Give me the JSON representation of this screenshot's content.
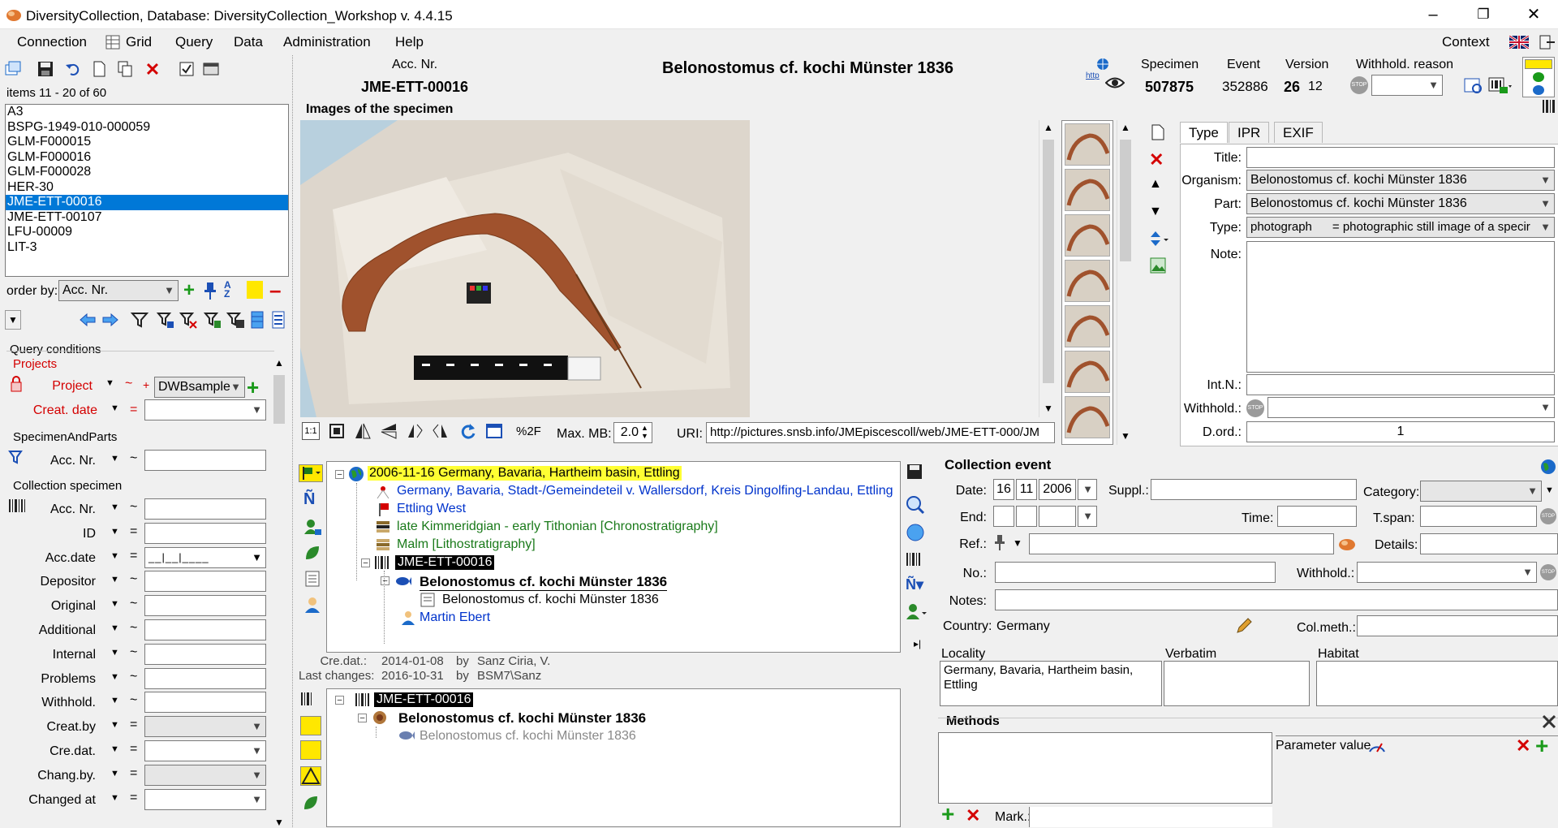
{
  "app": {
    "title": "DiversityCollection,  Database: DiversityCollection_Workshop    v. 4.4.15"
  },
  "menu": [
    "Connection",
    "Grid",
    "Query",
    "Data",
    "Administration",
    "Help"
  ],
  "context_label": "Context",
  "list": {
    "count_label": "items 11 - 20 of 60",
    "items": [
      "A3",
      "BSPG-1949-010-000059",
      "GLM-F000015",
      "GLM-F000016",
      "GLM-F000028",
      "HER-30",
      "JME-ETT-00016",
      "JME-ETT-00107",
      "LFU-00009",
      "LIT-3"
    ],
    "selected_index": 6
  },
  "orderby": {
    "label": "order by:",
    "value": "Acc. Nr."
  },
  "query": {
    "header": "Query conditions",
    "projects_group": "Projects",
    "project_label": "Project",
    "project_value": "DWBsample",
    "creat_date_label": "Creat. date",
    "sp_group": "SpecimenAndParts",
    "sp_accnr": "Acc. Nr.",
    "cs_group": "Collection specimen",
    "fields": [
      "Acc. Nr.",
      "ID",
      "Acc.date",
      "Depositor",
      "Original",
      "Additional",
      "Internal",
      "Problems",
      "Withhold.",
      "Creat.by",
      "Cre.dat.",
      "Chang.by.",
      "Changed at"
    ],
    "ops": [
      "~",
      "=",
      "=",
      "~",
      "~",
      "~",
      "~",
      "~",
      "~",
      "=",
      "=",
      "=",
      "="
    ]
  },
  "header": {
    "acc_label": "Acc. Nr.",
    "acc_value": "JME-ETT-00016",
    "title": "Belonostomus cf. kochi Münster 1836",
    "http_label": "http",
    "specimen_label": "Specimen",
    "specimen_value": "507875",
    "event_label": "Event",
    "event_value": "352886",
    "version_label": "Version",
    "version_value": "26",
    "version_sub": "12",
    "withhold_label": "Withhold. reason"
  },
  "images": {
    "section_title": "Images of the specimen",
    "percent_label": "%2F",
    "maxmb_label": "Max. MB:",
    "maxmb_value": "2.0",
    "uri_label": "URI:",
    "uri_value": "http://pictures.snsb.info/JMEpiscescoll/web/JME-ETT-000/JM"
  },
  "props": {
    "tabs": [
      "Type",
      "IPR",
      "EXIF"
    ],
    "title_label": "Title:",
    "title_value": "",
    "organism_label": "Organism:",
    "organism_value": "Belonostomus cf. kochi Münster 1836",
    "part_label": "Part:",
    "part_value": "Belonostomus cf. kochi Münster 1836",
    "type_label": "Type:",
    "type_value": "photograph      = photographic still image of a specir",
    "note_label": "Note:",
    "intn_label": "Int.N.:",
    "withhold_label": "Withhold.:",
    "dord_label": "D.ord.:",
    "dord_value": "1"
  },
  "tree": {
    "event_node": "2006-11-16 Germany, Bavaria, Hartheim basin, Ettling",
    "locality_node": "Germany, Bavaria, Stadt-/Gemeindeteil v. Wallersdorf, Kreis Dingolfing-Landau, Ettling",
    "site_node": "Ettling West",
    "chrono_node": "late Kimmeridgian - early Tithonian [Chronostratigraphy]",
    "litho_node": "Malm [Lithostratigraphy]",
    "specimen_node": "JME-ETT-00016",
    "taxon_node": "Belonostomus cf. kochi Münster 1836",
    "part_node": "Belonostomus cf. kochi Münster 1836",
    "agent_node": "Martin Ebert",
    "cre_label": "Cre.dat.:",
    "cre_date": "2014-01-08",
    "by1": "by",
    "cre_by": "Sanz Ciria, V.",
    "chg_label": "Last changes:",
    "chg_date": "2016-10-31",
    "by2": "by",
    "chg_by": "BSM7\\Sanz"
  },
  "tree2": {
    "specimen_node": "JME-ETT-00016",
    "taxon_node": "Belonostomus cf. kochi Münster 1836",
    "part_node": "Belonostomus cf. kochi Münster 1836"
  },
  "event": {
    "title": "Collection event",
    "date_label": "Date:",
    "day": "16",
    "month": "11",
    "year": "2006",
    "suppl_label": "Suppl.:",
    "category_label": "Category:",
    "end_label": "End:",
    "time_label": "Time:",
    "tspan_label": "T.span:",
    "ref_label": "Ref.:",
    "details_label": "Details:",
    "no_label": "No.:",
    "withhold_label": "Withhold.:",
    "notes_label": "Notes:",
    "country_label": "Country:",
    "country_value": "Germany",
    "colmeth_label": "Col.meth.:",
    "locality_label": "Locality",
    "locality_value": "Germany, Bavaria, Hartheim basin, Ettling",
    "verbatim_label": "Verbatim",
    "habitat_label": "Habitat",
    "methods_title": "Methods",
    "param_label": "Parameter value",
    "mark_label": "Mark.:"
  },
  "colors": {
    "selection": "#0078d7",
    "highlight": "#ffff33",
    "tree_blue": "#0033cc",
    "tree_green": "#1a7a1a"
  }
}
